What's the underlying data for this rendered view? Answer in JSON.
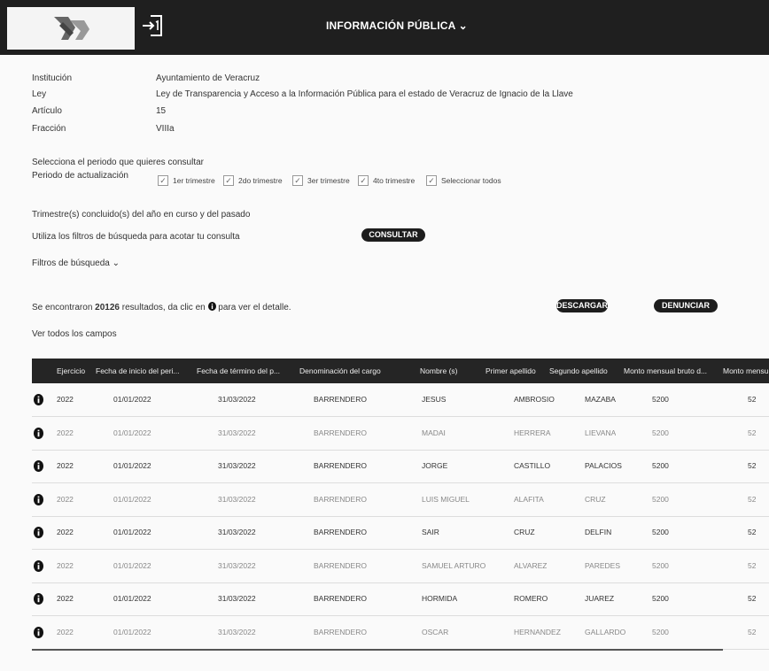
{
  "header": {
    "title": "INFORMACIÓN PÚBLICA"
  },
  "details": [
    {
      "label": "Institución",
      "value": "Ayuntamiento de Veracruz"
    },
    {
      "label": "Ley",
      "value": "Ley de Transparencia y Acceso a la Información Pública para el estado de Veracruz de Ignacio de la Llave"
    },
    {
      "label": "Artículo",
      "value": "15"
    },
    {
      "label": "Fracción",
      "value": "VIIIa"
    }
  ],
  "period": {
    "prompt": "Selecciona el periodo que quieres consultar",
    "label": "Periodo de actualización",
    "options": [
      "1er trimestre",
      "2do trimestre",
      "3er trimestre",
      "4to trimestre",
      "Seleccionar todos"
    ],
    "note": "Trimestre(s) concluido(s) del año en curso y del pasado"
  },
  "filters": {
    "hint": "Utiliza los filtros de búsqueda para acotar tu consulta",
    "consult_label": "CONSULTAR",
    "toggle_label": "Filtros de búsqueda"
  },
  "results": {
    "prefix": "Se encontraron",
    "count": "20126",
    "suffix_a": "resultados, da clic en",
    "suffix_b": "para ver el detalle.",
    "download_label": "DESCARGAR",
    "report_label": "DENUNCIAR",
    "all_fields": "Ver todos los campos"
  },
  "table": {
    "columns": [
      "Ejercicio",
      "Fecha de inicio del peri...",
      "Fecha de término del p...",
      "Denominación del cargo",
      "Nombre (s)",
      "Primer apellido",
      "Segundo apellido",
      "Monto mensual bruto d...",
      "Monto mensu"
    ],
    "rows": [
      [
        "2022",
        "01/01/2022",
        "31/03/2022",
        "BARRENDERO",
        "JESUS",
        "AMBROSIO",
        "MAZABA",
        "5200",
        "52"
      ],
      [
        "2022",
        "01/01/2022",
        "31/03/2022",
        "BARRENDERO",
        "MADAI",
        "HERRERA",
        "LIEVANA",
        "5200",
        "52"
      ],
      [
        "2022",
        "01/01/2022",
        "31/03/2022",
        "BARRENDERO",
        "JORGE",
        "CASTILLO",
        "PALACIOS",
        "5200",
        "52"
      ],
      [
        "2022",
        "01/01/2022",
        "31/03/2022",
        "BARRENDERO",
        "LUIS MIGUEL",
        "ALAFITA",
        "CRUZ",
        "5200",
        "52"
      ],
      [
        "2022",
        "01/01/2022",
        "31/03/2022",
        "BARRENDERO",
        "SAIR",
        "CRUZ",
        "DELFIN",
        "5200",
        "52"
      ],
      [
        "2022",
        "01/01/2022",
        "31/03/2022",
        "BARRENDERO",
        "SAMUEL ARTURO",
        "ALVAREZ",
        "PAREDES",
        "5200",
        "52"
      ],
      [
        "2022",
        "01/01/2022",
        "31/03/2022",
        "BARRENDERO",
        "HORMIDA",
        "ROMERO",
        "JUAREZ",
        "5200",
        "52"
      ],
      [
        "2022",
        "01/01/2022",
        "31/03/2022",
        "BARRENDERO",
        "OSCAR",
        "HERNANDEZ",
        "GALLARDO",
        "5200",
        "52"
      ]
    ]
  }
}
